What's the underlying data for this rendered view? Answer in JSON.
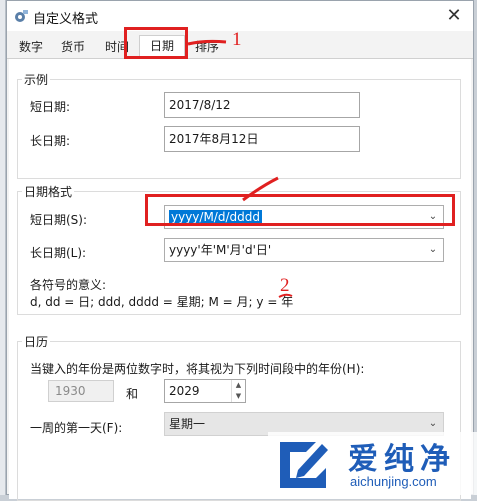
{
  "window": {
    "title": "自定义格式",
    "close": "✕"
  },
  "tabs": [
    {
      "label": "数字"
    },
    {
      "label": "货币"
    },
    {
      "label": "时间"
    },
    {
      "label": "日期"
    },
    {
      "label": "排序"
    }
  ],
  "example": {
    "group_title": "示例",
    "short_date_label": "短日期:",
    "short_date_value": "2017/8/12",
    "long_date_label": "长日期:",
    "long_date_value": "2017年8月12日"
  },
  "date_formats": {
    "group_title": "日期格式",
    "short_date_label": "短日期(S):",
    "short_date_value": "yyyy/M/d/dddd",
    "long_date_label": "长日期(L):",
    "long_date_value": "yyyy'年'M'月'd'日'",
    "symbols_title": "各符号的意义:",
    "symbols_text": "d, dd = 日;  ddd, dddd = 星期;  M = 月;  y = 年"
  },
  "calendar": {
    "group_title": "日历",
    "two_digit_text": "当键入的年份是两位数字时，将其视为下列时间段中的年份(H):",
    "from_year": "1930",
    "and_label": "和",
    "to_year": "2029",
    "first_day_label": "一周的第一天(F):",
    "first_day_value": "星期一"
  },
  "annotations": {
    "marker_1": "1",
    "marker_2": "2",
    "accent_color": "#e02020"
  },
  "watermark": {
    "title": "爱纯净",
    "url": "aichunjing.com",
    "color": "#1f5db8"
  }
}
